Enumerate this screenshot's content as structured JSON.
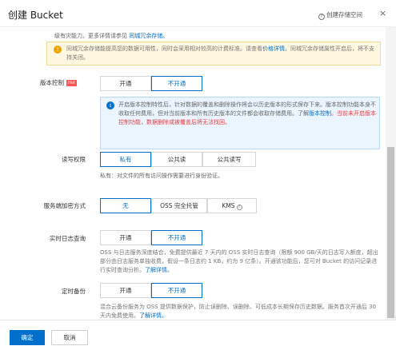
{
  "header": {
    "title": "创建 Bucket",
    "help_label": "创建存储空间",
    "close_glyph": "×"
  },
  "redundancy": {
    "top_fragment": "级有灾能力。更多详情请参见",
    "top_link": "同城冗余存储。",
    "notice_part1": "同城冗余存储能提高您的数据可用性，同时会采用相对较高的计费标准。请查看",
    "notice_link": "价格详情",
    "notice_part2": "。同城冗余存储属性开启后，将不支持关闭。"
  },
  "versioning": {
    "label": "版本控制",
    "badge": "Hot",
    "options": [
      "开通",
      "不开通"
    ],
    "notice_text1": "开启版本控制特性后，针对数据的覆盖和删除操作将会以历史版本的形式保存下来。版本控制功能本身不收取任何费用，但对当前版本和所有历史版本的文件都会收取存储费用。了解",
    "notice_link": "版本控制",
    "notice_red": "。当前未开启版本控制功能，数据删除或被覆盖后将无法找回。"
  },
  "acl": {
    "label": "读写权限",
    "options": [
      "私有",
      "公共读",
      "公共读写"
    ],
    "desc": "私有：对文件的所有访问操作需要进行身份验证。"
  },
  "encryption": {
    "label": "服务端加密方式",
    "options": [
      "无",
      "OSS 完全托管",
      "KMS"
    ],
    "kms_icon": "?"
  },
  "realtime_log": {
    "label": "实时日志查询",
    "options": [
      "开通",
      "不开通"
    ],
    "desc_text": "OSS 与日志服务深度结合，免费提供最近 7 天内的 OSS 实时日志查询（限额 900 GB/天的日志写入额度，超出部分由日志服务单独收费，假设一条日志约 1 KB，约为 9 亿条）。开通该功能后，您可对 Bucket 的访问记录进行实时查询分析。",
    "desc_link": "了解详情。"
  },
  "backup": {
    "label": "定时备份",
    "options": [
      "开通",
      "不开通"
    ],
    "desc_text": "混合云备份服务为 OSS 提供数据保护，防止误删除、误删除、可低成本长期保存历史数据。服务首次开通后 30 天内免费使用。",
    "desc_link": "了解详情。"
  },
  "footer": {
    "confirm": "确定",
    "cancel": "取消"
  },
  "colors": {
    "primary": "#0070cc",
    "warning_bg": "#fff7e0",
    "info_bg": "#ebf5ff",
    "danger": "#e64040"
  }
}
